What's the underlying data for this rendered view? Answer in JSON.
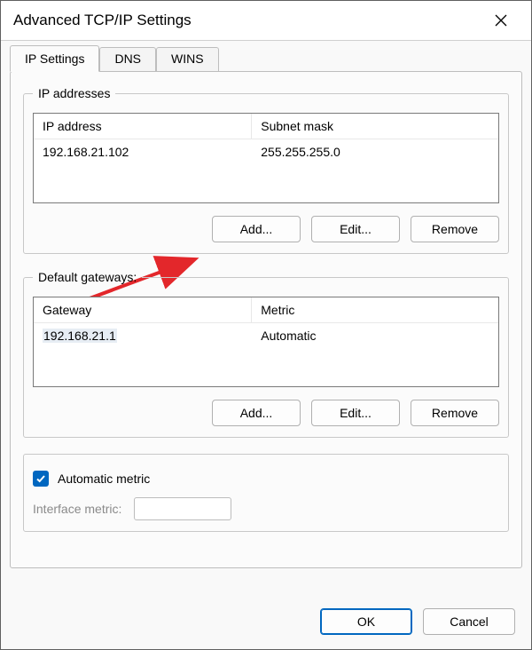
{
  "window": {
    "title": "Advanced TCP/IP Settings"
  },
  "tabs": {
    "ip_settings": "IP Settings",
    "dns": "DNS",
    "wins": "WINS"
  },
  "ip_addresses": {
    "legend": "IP addresses",
    "col_ip": "IP address",
    "col_mask": "Subnet mask",
    "rows": [
      {
        "ip": "192.168.21.102",
        "mask": "255.255.255.0"
      }
    ],
    "add": "Add...",
    "edit": "Edit...",
    "remove": "Remove"
  },
  "gateways": {
    "legend": "Default gateways:",
    "col_gw": "Gateway",
    "col_metric": "Metric",
    "rows": [
      {
        "gw": "192.168.21.1",
        "metric": "Automatic"
      }
    ],
    "add": "Add...",
    "edit": "Edit...",
    "remove": "Remove"
  },
  "metric": {
    "auto_label": "Automatic metric",
    "iface_label": "Interface metric:",
    "iface_value": ""
  },
  "footer": {
    "ok": "OK",
    "cancel": "Cancel"
  }
}
